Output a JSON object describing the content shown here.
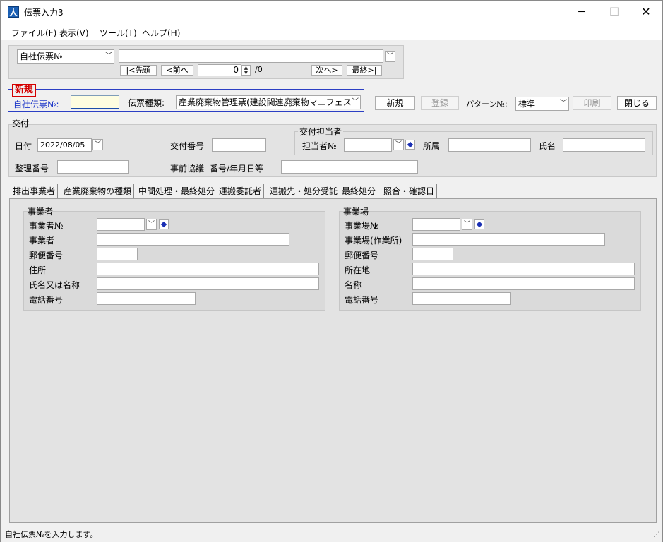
{
  "window": {
    "title": "伝票入力3",
    "minimize": "─",
    "maximize": "☐",
    "close": "✕"
  },
  "menu": [
    "ファイル(F)",
    "表示(V)",
    "ツール(T)",
    "ヘルプ(H)"
  ],
  "search": {
    "field_select": "自社伝票№",
    "query": "",
    "first_label": "|<先頭",
    "prev_label": "<前へ",
    "record_position": "0",
    "record_total": "/0",
    "next_label": "次へ>",
    "last_label": "最終>|"
  },
  "header": {
    "mode_badge": "新規",
    "voucher_no_label": "自社伝票№:",
    "voucher_no_value": "",
    "voucher_type_label": "伝票種類:",
    "voucher_type_value": "産業廃棄物管理票(建設関連廃棄物マニフェスト)",
    "new_button": "新規",
    "register_button": "登録",
    "pattern_label": "パターン№:",
    "pattern_value": "標準",
    "print_button": "印刷",
    "close_button": "閉じる"
  },
  "issuance": {
    "group_title": "交付",
    "date_label": "日付",
    "date_value": "2022/08/05",
    "issue_no_label": "交付番号",
    "issue_no_value": "",
    "control_no_label": "整理番号",
    "control_no_value": "",
    "prior_consult_label": "事前協議",
    "prior_consult_sub_label": "番号/年月日等",
    "prior_consult_value": "",
    "person_group_title": "交付担当者",
    "person_no_label": "担当者№",
    "person_no_value": "",
    "department_label": "所属",
    "department_value": "",
    "name_label": "氏名",
    "name_value": ""
  },
  "tabs": [
    {
      "label": "排出事業者",
      "active": true
    },
    {
      "label": "産業廃棄物の種類",
      "active": false
    },
    {
      "label": "中間処理・最終処分",
      "active": false
    },
    {
      "label": "運搬委託者",
      "active": false
    },
    {
      "label": "運搬先・処分受託",
      "active": false
    },
    {
      "label": "最終処分",
      "active": false
    },
    {
      "label": "照合・確認日",
      "active": false
    }
  ],
  "business_operator": {
    "group_title": "事業者",
    "operator_no_label": "事業者№",
    "operator_label": "事業者",
    "postal_label": "郵便番号",
    "address_label": "住所",
    "name_label": "氏名又は名称",
    "phone_label": "電話番号"
  },
  "business_site": {
    "group_title": "事業場",
    "site_no_label": "事業場№",
    "site_label": "事業場(作業所)",
    "postal_label": "郵便番号",
    "location_label": "所在地",
    "name_label": "名称",
    "phone_label": "電話番号"
  },
  "status": {
    "message": "自社伝票№を入力します。"
  },
  "colors": {
    "badge_red": "#d40000",
    "label_blue": "#1a35c8",
    "panel_gray": "#e3e3e3"
  }
}
